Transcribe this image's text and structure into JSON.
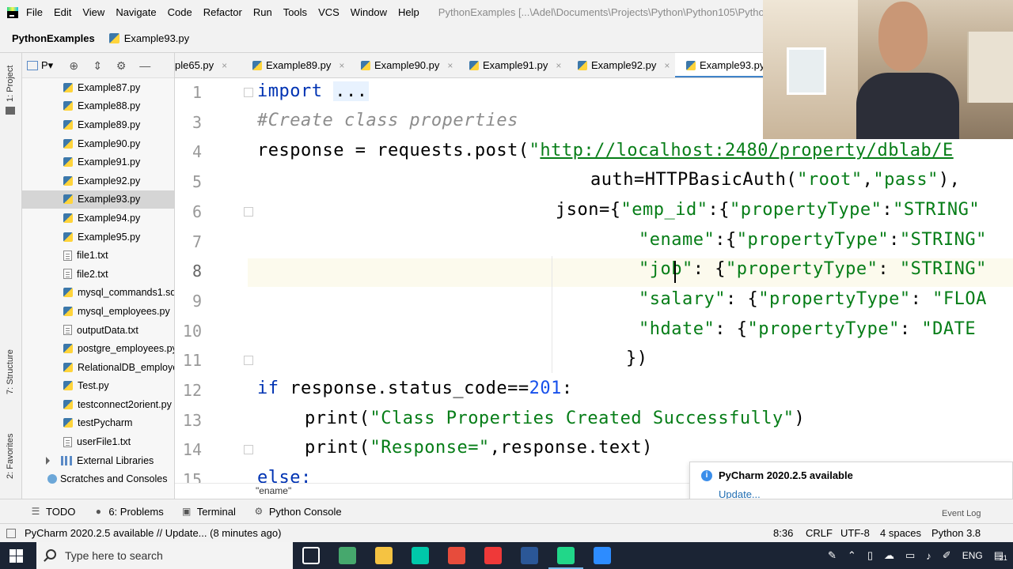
{
  "menu": {
    "items": [
      "File",
      "Edit",
      "View",
      "Navigate",
      "Code",
      "Refactor",
      "Run",
      "Tools",
      "VCS",
      "Window",
      "Help"
    ],
    "window_title": "PythonExamples [...\\Adel\\Documents\\Projects\\Python\\Python105\\Pytho"
  },
  "breadcrumb": {
    "project": "PythonExamples",
    "file": "Example93.py"
  },
  "left_stripe": {
    "project": "1: Project",
    "structure": "7: Structure",
    "favorites": "2: Favorites"
  },
  "project_panel": {
    "title_fragment": "P▾",
    "tree": [
      {
        "label": "Example87.py",
        "type": "py"
      },
      {
        "label": "Example88.py",
        "type": "py"
      },
      {
        "label": "Example89.py",
        "type": "py"
      },
      {
        "label": "Example90.py",
        "type": "py"
      },
      {
        "label": "Example91.py",
        "type": "py"
      },
      {
        "label": "Example92.py",
        "type": "py"
      },
      {
        "label": "Example93.py",
        "type": "py",
        "selected": true
      },
      {
        "label": "Example94.py",
        "type": "py"
      },
      {
        "label": "Example95.py",
        "type": "py"
      },
      {
        "label": "file1.txt",
        "type": "txt"
      },
      {
        "label": "file2.txt",
        "type": "txt"
      },
      {
        "label": "mysql_commands1.sq",
        "type": "py"
      },
      {
        "label": "mysql_employees.py",
        "type": "py"
      },
      {
        "label": "outputData.txt",
        "type": "txt"
      },
      {
        "label": "postgre_employees.py",
        "type": "py"
      },
      {
        "label": "RelationalDB_employe",
        "type": "py"
      },
      {
        "label": "Test.py",
        "type": "py"
      },
      {
        "label": "testconnect2orient.py",
        "type": "py"
      },
      {
        "label": "testPycharm",
        "type": "py"
      },
      {
        "label": "userFile1.txt",
        "type": "txt"
      }
    ],
    "external_libraries": "External Libraries",
    "scratches": "Scratches and Consoles"
  },
  "editor_tabs": [
    {
      "label": "ple65.py",
      "active": false
    },
    {
      "label": "Example89.py",
      "active": false
    },
    {
      "label": "Example90.py",
      "active": false
    },
    {
      "label": "Example91.py",
      "active": false
    },
    {
      "label": "Example92.py",
      "active": false
    },
    {
      "label": "Example93.py",
      "active": true
    }
  ],
  "editor": {
    "line_numbers": [
      "1",
      "3",
      "4",
      "5",
      "6",
      "7",
      "8",
      "9",
      "10",
      "11",
      "12",
      "13",
      "14",
      "15"
    ],
    "current_line": "8",
    "code": {
      "l1_kw": "import",
      "l1_fold": "...",
      "l3": "#Create class properties",
      "l4_a": "response = requests.post(",
      "l4_q": "\"",
      "l4_url": "http://localhost:2480/property/dblab/E",
      "l5_a": "auth=HTTPBasicAuth(",
      "l5_s1": "\"root\"",
      "l5_c": ",",
      "l5_s2": "\"pass\"",
      "l5_e": "),",
      "l6_a": "json={",
      "l6_s1": "\"emp_id\"",
      "l6_b": ":{",
      "l6_s2": "\"propertyType\"",
      "l6_c": ":",
      "l6_s3": "\"STRING\"",
      "l7_s1": "\"ename\"",
      "l7_b": ":{",
      "l7_s2": "\"propertyType\"",
      "l7_c": ":",
      "l7_s3": "\"STRING\"",
      "l8_s1": "\"job\"",
      "l8_b": ": {",
      "l8_s2": "\"propertyType\"",
      "l8_c": ": ",
      "l8_s3": "\"STRING\"",
      "l9_s1": "\"salary\"",
      "l9_b": ": {",
      "l9_s2": "\"propertyType\"",
      "l9_c": ": ",
      "l9_s3": "\"FLOA",
      "l10_s1": "\"hdate\"",
      "l10_b": ": {",
      "l10_s2": "\"propertyType\"",
      "l10_c": ": ",
      "l10_s3": "\"DATE",
      "l11": "})",
      "l12_kw": "if",
      "l12_a": " response.status_code==",
      "l12_num": "201",
      "l12_e": ":",
      "l13_a": "print(",
      "l13_s": "\"Class Properties Created Successfully\"",
      "l13_e": ")",
      "l14_a": "print(",
      "l14_s": "\"Response=\"",
      "l14_e": ",response.text)",
      "l15_kw": "else:"
    },
    "footer_breadcrumb": "\"ename\""
  },
  "notification": {
    "title": "PyCharm 2020.2.5 available",
    "link": "Update...",
    "event_log": "Event Log"
  },
  "tool_windows": [
    {
      "label": "TODO",
      "glyph": "☰"
    },
    {
      "label": "6: Problems",
      "glyph": "●"
    },
    {
      "label": "Terminal",
      "glyph": "▣"
    },
    {
      "label": "Python Console",
      "glyph": "⚙"
    }
  ],
  "status_bar": {
    "message": "PyCharm 2020.2.5 available // Update... (8 minutes ago)",
    "position": "8:36",
    "line_sep": "CRLF",
    "encoding": "UTF-8",
    "indent": "4 spaces",
    "interpreter": "Python 3.8"
  },
  "taskbar": {
    "search_placeholder": "Type here to search",
    "language": "ENG",
    "notification_count": "21",
    "apps": [
      {
        "name": "task-view",
        "color": "#ffffff"
      },
      {
        "name": "spreadsheet-app",
        "color": "#46a86d"
      },
      {
        "name": "file-explorer",
        "color": "#f5c342"
      },
      {
        "name": "audition",
        "color": "#00c8aa"
      },
      {
        "name": "chrome",
        "color": "#e74c3c"
      },
      {
        "name": "vivaldi",
        "color": "#ef3939"
      },
      {
        "name": "word",
        "color": "#2b5797"
      },
      {
        "name": "pycharm",
        "color": "#21d789"
      },
      {
        "name": "zoom",
        "color": "#2d8cff"
      }
    ]
  }
}
